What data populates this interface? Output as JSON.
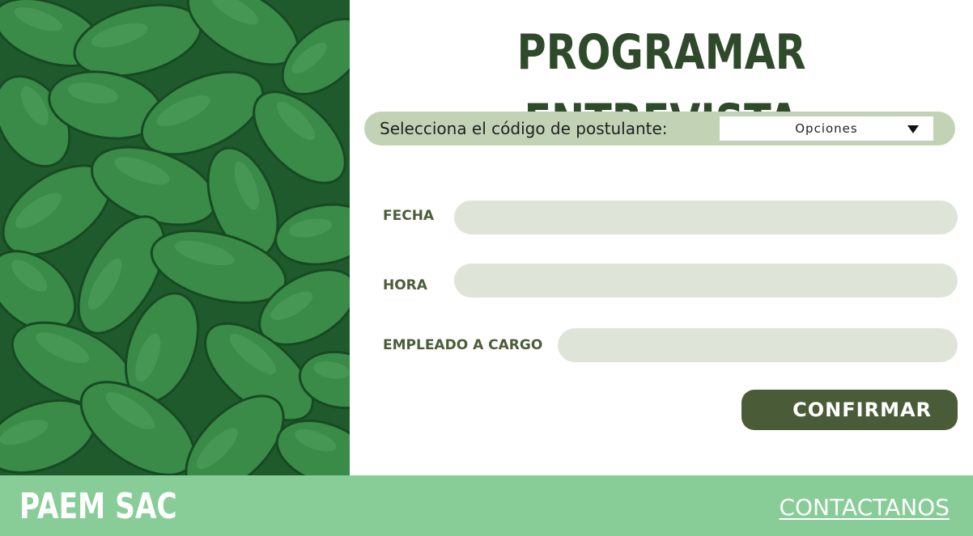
{
  "page": {
    "title": "PROGRAMAR ENTREVISTA"
  },
  "applicant_selector": {
    "label": "Selecciona el código de postulante:",
    "dropdown_value": "Opciones"
  },
  "form": {
    "fields": [
      {
        "label": "FECHA",
        "value": ""
      },
      {
        "label": "HORA",
        "value": ""
      },
      {
        "label": "EMPLEADO A CARGO",
        "value": ""
      }
    ],
    "confirm_label": "CONFIRMAR"
  },
  "footer": {
    "brand": "PAEM SAC",
    "contact_label": "CONTACTANOS"
  },
  "colors": {
    "title": "#2e4a2a",
    "label": "#4b5e38",
    "selector_bar": "#c2d3b5",
    "input_background": "#dfe4d8",
    "button": "#4a5c37",
    "footer": "#88cc98",
    "image_tint": "#2f6e3c"
  },
  "icons": {
    "dropdown": "caret-down-icon"
  }
}
